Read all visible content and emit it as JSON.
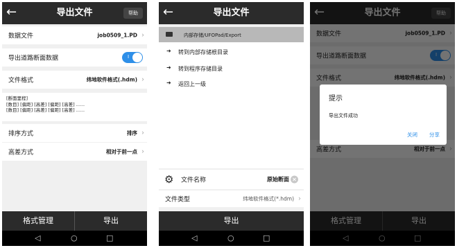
{
  "panel1": {
    "back_icon": "←",
    "title": "导出文件",
    "help_label": "帮助",
    "data_file_label": "数据文件",
    "data_file_value": "job0509_1.PD",
    "export_road_label": "导出道路断面数据",
    "toggle_on": true,
    "toggle_mark": "I",
    "file_format_label": "文件格式",
    "file_format_value": "纬地软件格式(.hdm)",
    "desc_line1": "[断面里程]",
    "desc_line2": "[数目] [偏距] [高差] [偏距] [高差] ......",
    "desc_line3": "[数目] [偏距] [高差] [偏距] [高差] ......",
    "sort_label": "排序方式",
    "sort_value": "排序",
    "height_label": "高差方式",
    "height_value": "相对于前一点",
    "format_manage_label": "格式管理",
    "export_label": "导出"
  },
  "panel2": {
    "back_icon": "←",
    "title": "导出文件",
    "path": "内部存储/UFOPad/Export",
    "items": [
      "转到内部存储根目录",
      "转到程序存储目录",
      "返回上一级"
    ],
    "file_name_label": "文件名称",
    "file_name_value": "原始断面",
    "file_type_label": "文件类型",
    "file_type_value": "纬地软件格式(*.hdm)",
    "export_label": "导出"
  },
  "panel3": {
    "dialog_title": "提示",
    "dialog_message": "导出文件成功",
    "close_label": "关闭",
    "share_label": "分享"
  },
  "navbar": {
    "back": "◁",
    "home": "○",
    "recent": "□"
  },
  "icons": {
    "chevron": "›",
    "pin": "➜",
    "gear": "⚙",
    "clear": "×",
    "folder": "folder-icon"
  },
  "colors": {
    "accent": "#2e8fe8",
    "bar": "#2b2b2b"
  }
}
